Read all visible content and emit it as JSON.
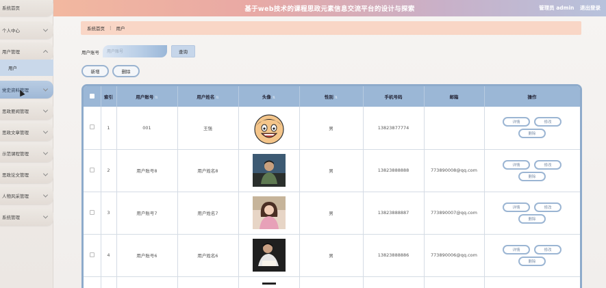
{
  "header": {
    "title": "基于web技术的课程思政元素信息交流平台的设计与探索",
    "user_label": "管理员 admin",
    "logout_label": "退出登录"
  },
  "sidebar": {
    "items": [
      {
        "label": "系统首页"
      },
      {
        "label": "个人中心"
      },
      {
        "label": "用户管理"
      },
      {
        "label": "党史资料管理"
      },
      {
        "label": "思政要闻管理"
      },
      {
        "label": "思政文章管理"
      },
      {
        "label": "示范课程管理"
      },
      {
        "label": "思政论文管理"
      },
      {
        "label": "人物风采管理"
      },
      {
        "label": "系统管理"
      }
    ],
    "submenu_label": "用户"
  },
  "breadcrumb": {
    "home": "系统首页",
    "separator": "⋮",
    "current": "用户"
  },
  "search": {
    "label": "用户账号",
    "placeholder": "用户账号",
    "button": "查询"
  },
  "actions": {
    "add": "新增",
    "delete": "删除"
  },
  "table": {
    "headers": [
      "索引",
      "用户账号",
      "用户姓名",
      "头像",
      "性别",
      "手机号码",
      "邮箱",
      "操作"
    ],
    "op_labels": {
      "detail": "详情",
      "edit": "修改",
      "delete": "删除"
    },
    "rows": [
      {
        "index": "1",
        "account": "001",
        "name": "王强",
        "gender": "男",
        "phone": "13823877774",
        "email": ""
      },
      {
        "index": "2",
        "account": "用户账号8",
        "name": "用户姓名8",
        "gender": "男",
        "phone": "13823888888",
        "email": "773890008@qq.com"
      },
      {
        "index": "3",
        "account": "用户账号7",
        "name": "用户姓名7",
        "gender": "男",
        "phone": "13823888887",
        "email": "773890007@qq.com"
      },
      {
        "index": "4",
        "account": "用户账号6",
        "name": "用户姓名6",
        "gender": "男",
        "phone": "13823888886",
        "email": "773890006@qq.com"
      }
    ]
  },
  "colors": {
    "accent": "#9bb7d6",
    "breadcrumb_bg": "#f9d6c6",
    "header_start": "#f2b8a0",
    "header_end": "#b7c2dc"
  }
}
